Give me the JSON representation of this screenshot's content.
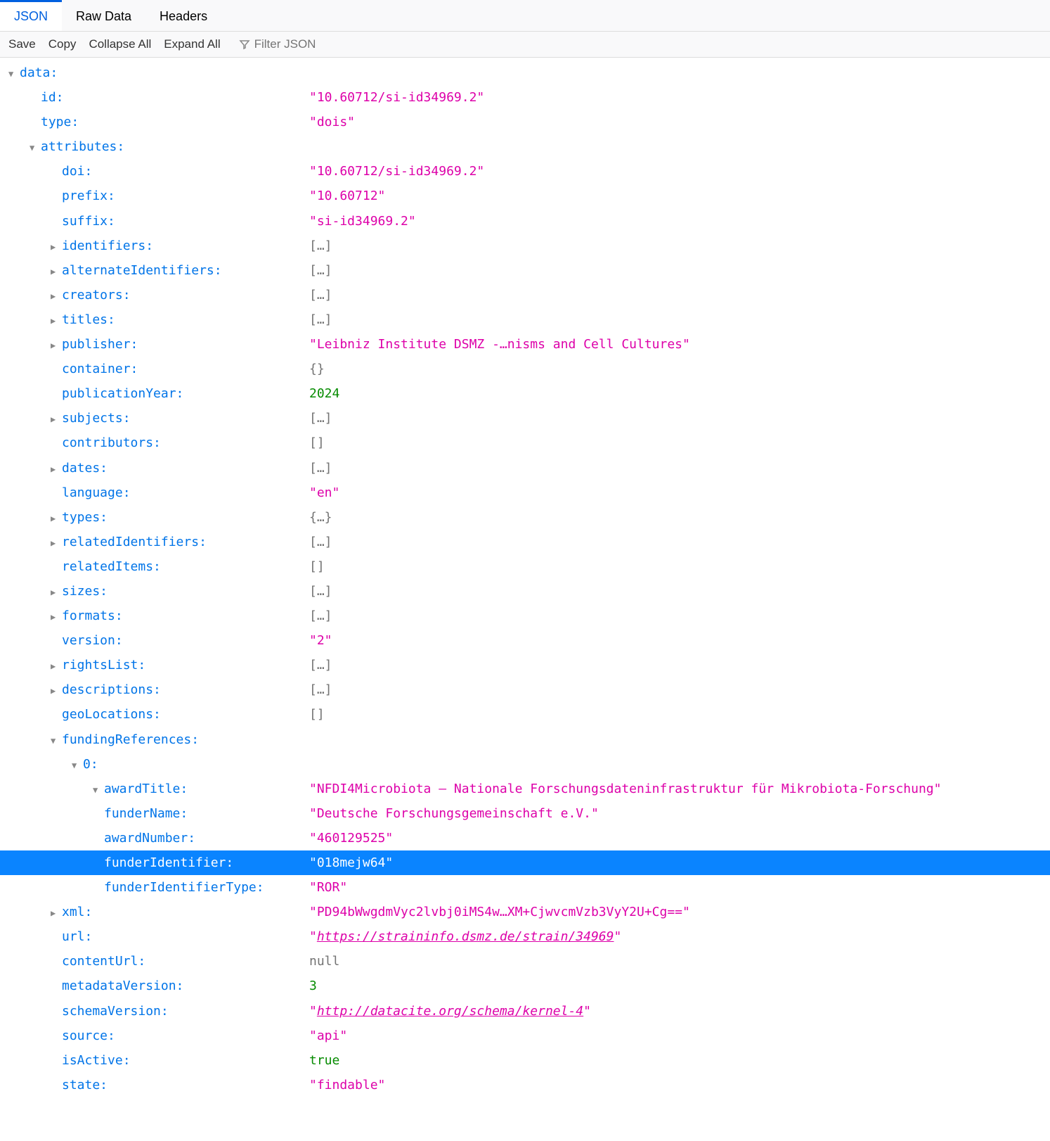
{
  "tabs": {
    "json": "JSON",
    "raw": "Raw Data",
    "headers": "Headers"
  },
  "toolbar": {
    "save": "Save",
    "copy": "Copy",
    "collapse": "Collapse All",
    "expand": "Expand All",
    "filter_placeholder": "Filter JSON"
  },
  "tree": {
    "data": "data:",
    "id_k": "id:",
    "id_v": "\"10.60712/si-id34969.2\"",
    "type_k": "type:",
    "type_v": "\"dois\"",
    "attributes": "attributes:",
    "doi_k": "doi:",
    "doi_v": "\"10.60712/si-id34969.2\"",
    "prefix_k": "prefix:",
    "prefix_v": "\"10.60712\"",
    "suffix_k": "suffix:",
    "suffix_v": "\"si-id34969.2\"",
    "identifiers_k": "identifiers:",
    "arr_collapsed": "[…]",
    "altid_k": "alternateIdentifiers:",
    "creators_k": "creators:",
    "titles_k": "titles:",
    "publisher_k": "publisher:",
    "publisher_v": "\"Leibniz Institute DSMZ -…nisms and Cell Cultures\"",
    "container_k": "container:",
    "obj_empty": "{}",
    "pubyear_k": "publicationYear:",
    "pubyear_v": "2024",
    "subjects_k": "subjects:",
    "contributors_k": "contributors:",
    "arr_empty": "[]",
    "dates_k": "dates:",
    "language_k": "language:",
    "language_v": "\"en\"",
    "types_k": "types:",
    "obj_collapsed": "{…}",
    "relid_k": "relatedIdentifiers:",
    "relitems_k": "relatedItems:",
    "sizes_k": "sizes:",
    "formats_k": "formats:",
    "version_k": "version:",
    "version_v": "\"2\"",
    "rights_k": "rightsList:",
    "desc_k": "descriptions:",
    "geo_k": "geoLocations:",
    "fundref_k": "fundingReferences:",
    "zero_k": "0:",
    "awardtitle_k": "awardTitle:",
    "awardtitle_v": "\"NFDI4Microbiota – Nationale Forschungsdateninfrastruktur für Mikrobiota-Forschung\"",
    "fundername_k": "funderName:",
    "fundername_v": "\"Deutsche Forschungsgemeinschaft e.V.\"",
    "awardnum_k": "awardNumber:",
    "awardnum_v": "\"460129525\"",
    "funderid_k": "funderIdentifier:",
    "funderid_v": "\"018mejw64\"",
    "funderidtype_k": "funderIdentifierType:",
    "funderidtype_v": "\"ROR\"",
    "xml_k": "xml:",
    "xml_v": "\"PD94bWwgdmVyc2lvbj0iMS4w…XM+CjwvcmVzb3VyY2U+Cg==\"",
    "url_k": "url:",
    "url_v_q1": "\"",
    "url_v_link": "https://straininfo.dsmz.de/strain/34969",
    "url_v_q2": "\"",
    "contenturl_k": "contentUrl:",
    "null_v": "null",
    "metaver_k": "metadataVersion:",
    "metaver_v": "3",
    "schemaver_k": "schemaVersion:",
    "schemaver_v_link": "http://datacite.org/schema/kernel-4",
    "source_k": "source:",
    "source_v": "\"api\"",
    "isactive_k": "isActive:",
    "isactive_v": "true",
    "state_k": "state:",
    "state_v": "\"findable\""
  }
}
